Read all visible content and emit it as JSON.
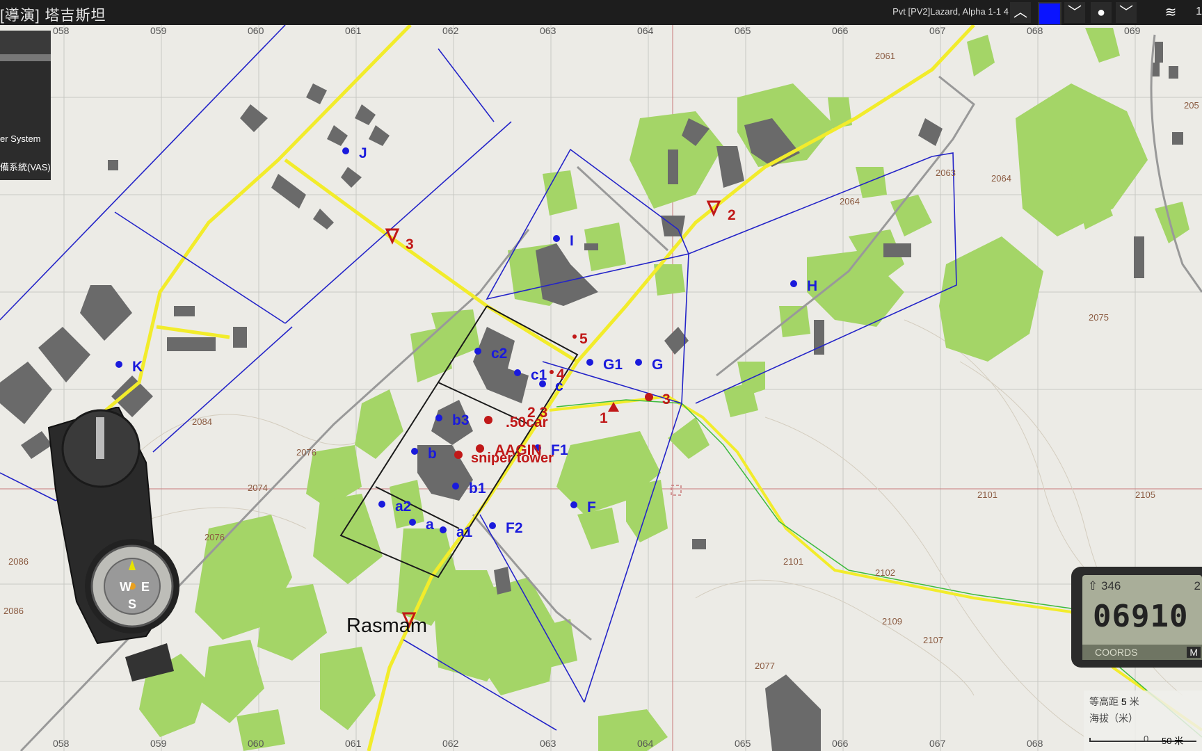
{
  "topbar": {
    "title": "[導演] 塔吉斯坦",
    "player": "Pvt [PV2]Lazard, Alpha 1-1 4",
    "buttons": [
      "chevron-up",
      "blue-color",
      "chevron-down",
      "dot",
      "chevron-down",
      "layers"
    ],
    "corner_text": "1"
  },
  "side_panel": {
    "items": [
      "er System",
      "備系統(VAS)"
    ]
  },
  "grid": {
    "top_labels": [
      "058",
      "059",
      "060",
      "061",
      "062",
      "063",
      "064",
      "065",
      "066",
      "067",
      "068",
      "069"
    ],
    "bottom_labels": [
      "058",
      "059",
      "060",
      "061",
      "062",
      "063",
      "064",
      "065",
      "066",
      "067",
      "068"
    ]
  },
  "elevations": [
    "2061",
    "2063",
    "2064",
    "2064",
    "2075",
    "2105",
    "2101",
    "2101",
    "2102",
    "2107",
    "2109",
    "2077",
    "2084",
    "2076",
    "2074",
    "2076",
    "2086",
    "2086",
    "205"
  ],
  "markers": {
    "blue": [
      "J",
      "K",
      "I",
      "H",
      "G1",
      "G",
      "c2",
      "c1",
      "c",
      "b3",
      "b",
      "b1",
      "a2",
      "a",
      "a1",
      "F1",
      "F",
      "F2"
    ],
    "red": [
      "2",
      "3",
      "5",
      "4",
      "3",
      "1",
      "2 3",
      ".50car",
      "AAGIN",
      "sniper tower"
    ],
    "place_name": "Rasmam"
  },
  "compass": {
    "n": "",
    "w": "W",
    "e": "E",
    "s": "S"
  },
  "gps": {
    "heading": "346",
    "heading_right": "2",
    "coords": "06910",
    "foot_left": "COORDS",
    "foot_right": "M"
  },
  "legend": {
    "contour_label": "等高距",
    "contour_value": "5",
    "contour_unit": "米",
    "elevation_label": "海拔（米）",
    "scale_left": "0",
    "scale_right": "50 米"
  },
  "colors": {
    "road_yellow": "#f2ec2b",
    "zone_blue": "#2424c8",
    "red_marker": "#c01818",
    "forest": "#9ed060",
    "building": "#6b6b6b"
  }
}
